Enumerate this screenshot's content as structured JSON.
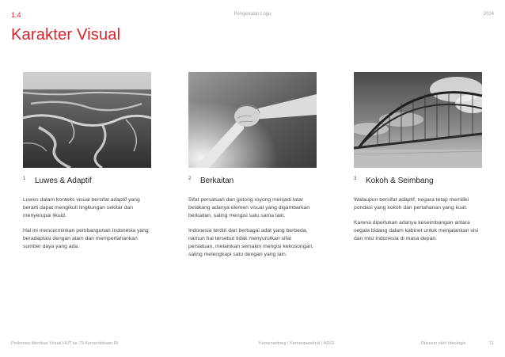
{
  "header": {
    "section_number": "1.4",
    "doc_title": "Pengenalan Logo",
    "year": "2024"
  },
  "page_title": "Karakter Visual",
  "items": [
    {
      "number": "1",
      "title": "Luwes & Adaptif",
      "image_subject": "aerial river delta landscape (grayscale)",
      "paragraphs": [
        "Luwes dalam konteks visual bersifat adaptif yang berarti dapat mengikuti lingkungan sekitar dan menyerupai likuid.",
        "Hal ini mencerminkan pembangunan Indonesia yang beradaptasi dengan alam dan mempertahankan sumber daya yang ada."
      ]
    },
    {
      "number": "2",
      "title": "Berkaitan",
      "image_subject": "two clasped hands (grayscale)",
      "paragraphs": [
        "Sifat persatuan dan gotong royong menjadi latar belakang adanya elemen visual yang digambarkan berkaitan, saling mengisi satu sama lain.",
        "Indonesia terdiri dari berbagai adat yang berbeda, namun hal tersebut tidak menyurutkan sifat persatuan, melainkan semakin mengisi kekosongan, saling melengkapi satu dengan yang lain."
      ]
    },
    {
      "number": "3",
      "title": "Kokoh & Seimbang",
      "image_subject": "steel arch bridge against cloudy sky (grayscale)",
      "paragraphs": [
        "Walaupun bersifat adaptif, negara tetap memiliki pondasi yang kokoh dan pertahanan yang kuat.",
        "Karena diperlukan adanya keseimbangan antara segala bidang dalam kabinet untuk menjalankan visi dan misi Indonesia di masa depan."
      ]
    }
  ],
  "footer": {
    "left": "Pedoman Identitas Visual HUT ke-79 Kemerdekaan RI",
    "center": "Kemensetneg | Kemenparekraf | ADGI",
    "credit": "Disusun oleh Ideologie",
    "page_number": "11"
  },
  "colors": {
    "accent": "#d8232a",
    "muted": "#a0a0a0",
    "body_text": "#444444"
  }
}
